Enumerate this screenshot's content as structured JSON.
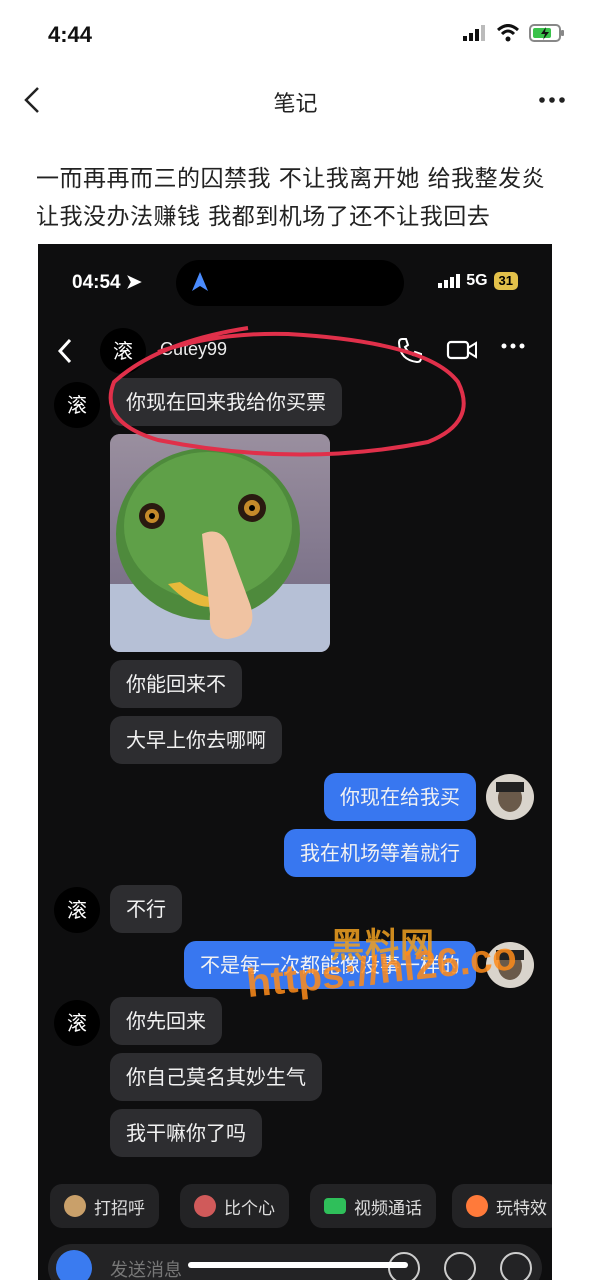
{
  "status_bar": {
    "time": "4:44"
  },
  "nav": {
    "title": "笔记"
  },
  "note": {
    "text": "一而再再而三的囚禁我 不让我离开她 给我整发炎 让我没办法赚钱 我都到机场了还不让我回去"
  },
  "embedded": {
    "status": {
      "time": "04:54",
      "network": "5G",
      "battery": "31"
    },
    "chat_header": {
      "avatar_text": "滚",
      "name": "Cutey99"
    },
    "messages": [
      {
        "side": "in",
        "text": "你现在回来我给你买票"
      },
      {
        "side": "in",
        "type": "sticker"
      },
      {
        "side": "in",
        "text": "你能回来不"
      },
      {
        "side": "in",
        "text": "大早上你去哪啊"
      },
      {
        "side": "out",
        "text": "你现在给我买"
      },
      {
        "side": "out",
        "text": "我在机场等着就行"
      },
      {
        "side": "in",
        "text": "不行"
      },
      {
        "side": "out",
        "text": "不是每一次都能像没事一样的"
      },
      {
        "side": "in",
        "text": "你先回来"
      },
      {
        "side": "in",
        "text": "你自己莫名其妙生气"
      },
      {
        "side": "in",
        "text": "我干嘛你了吗"
      }
    ],
    "quick_actions": [
      "打招呼",
      "比个心",
      "视频通话",
      "玩特效"
    ],
    "input_placeholder": "发送消息"
  },
  "watermark": {
    "line1": "黑料网",
    "line2": "https://hl26.co"
  },
  "colors": {
    "outgoing_bubble": "#3877f0",
    "incoming_bubble": "#2d2d30",
    "annotation": "#e0304a"
  }
}
